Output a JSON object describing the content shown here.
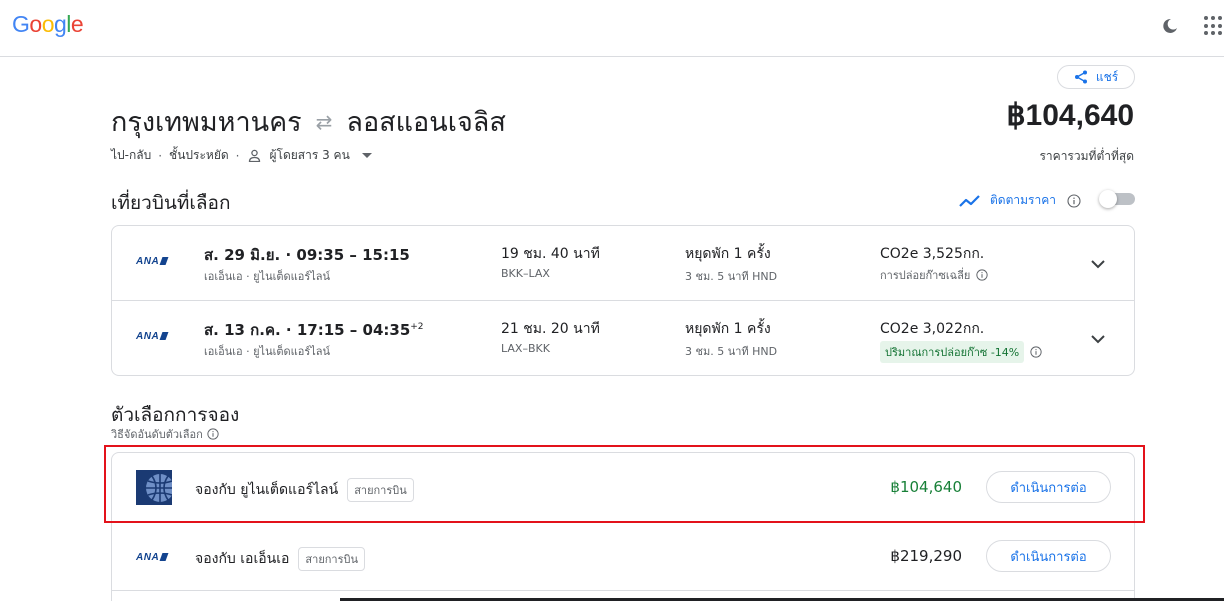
{
  "header": {
    "logo_letters": [
      {
        "ch": "G",
        "color": "#4285f4"
      },
      {
        "ch": "o",
        "color": "#ea4335"
      },
      {
        "ch": "o",
        "color": "#fbbc05"
      },
      {
        "ch": "g",
        "color": "#4285f4"
      },
      {
        "ch": "l",
        "color": "#34a853"
      },
      {
        "ch": "e",
        "color": "#ea4335"
      }
    ],
    "icons": [
      "dark-theme-icon",
      "apps-grid-icon"
    ]
  },
  "share_label": "แชร์",
  "trip": {
    "origin": "กรุงเทพมหานคร",
    "destination": "ลอสแอนเจลิส",
    "trip_type": "ไป-กลับ",
    "cabin": "ชั้นประหยัด",
    "passengers": "ผู้โดยสาร 3 คน",
    "total_price": "฿104,640",
    "total_price_label": "ราคารวมที่ต่ำที่สุด"
  },
  "selected_flights": {
    "title": "เที่ยวบินที่เลือก",
    "track_prices_label": "ติดตามราคา",
    "track_prices_on": false,
    "flights": [
      {
        "airline_logo_text": "ANA",
        "date_time": "ส. 29 มิ.ย. · 09:35 – 15:15",
        "day_offset": "",
        "airlines": "เอเอ็นเอ · ยูไนเต็ดแอร์ไลน์",
        "duration": "19 ชม. 40 นาที",
        "route": "BKK–LAX",
        "stops": "หยุดพัก 1 ครั้ง",
        "stop_info": "3 ชม. 5 นาที HND",
        "co2": "CO2e 3,525กก.",
        "emission_note": "การปล่อยก๊าซเฉลี่ย",
        "emission_badge": ""
      },
      {
        "airline_logo_text": "ANA",
        "date_time": "ส. 13 ก.ค. · 17:15 – 04:35",
        "day_offset": "+2",
        "airlines": "เอเอ็นเอ · ยูไนเต็ดแอร์ไลน์",
        "duration": "21 ชม. 20 นาที",
        "route": "LAX–BKK",
        "stops": "หยุดพัก 1 ครั้ง",
        "stop_info": "3 ชม. 5 นาที HND",
        "co2": "CO2e 3,022กก.",
        "emission_note": "",
        "emission_badge": "ปริมาณการปล่อยก๊าซ -14%"
      }
    ]
  },
  "booking": {
    "title": "ตัวเลือกการจอง",
    "sort_note": "วิธีจัดอันดับตัวเลือก",
    "options": [
      {
        "name": "จองกับ ยูไนเต็ดแอร์ไลน์",
        "chip": "สายการบิน",
        "price": "฿104,640",
        "price_color": "#188038",
        "button": "ดำเนินการต่อ",
        "logo": "united-airlines-globe-icon"
      },
      {
        "name": "จองกับ เอเอ็นเอ",
        "chip": "สายการบิน",
        "price": "฿219,290",
        "price_color": "#202124",
        "button": "ดำเนินการต่อ",
        "logo_text": "ANA"
      }
    ]
  },
  "colors": {
    "accent": "#1a73e8",
    "highlight_box": "#e3121b",
    "green_price": "#188038"
  }
}
